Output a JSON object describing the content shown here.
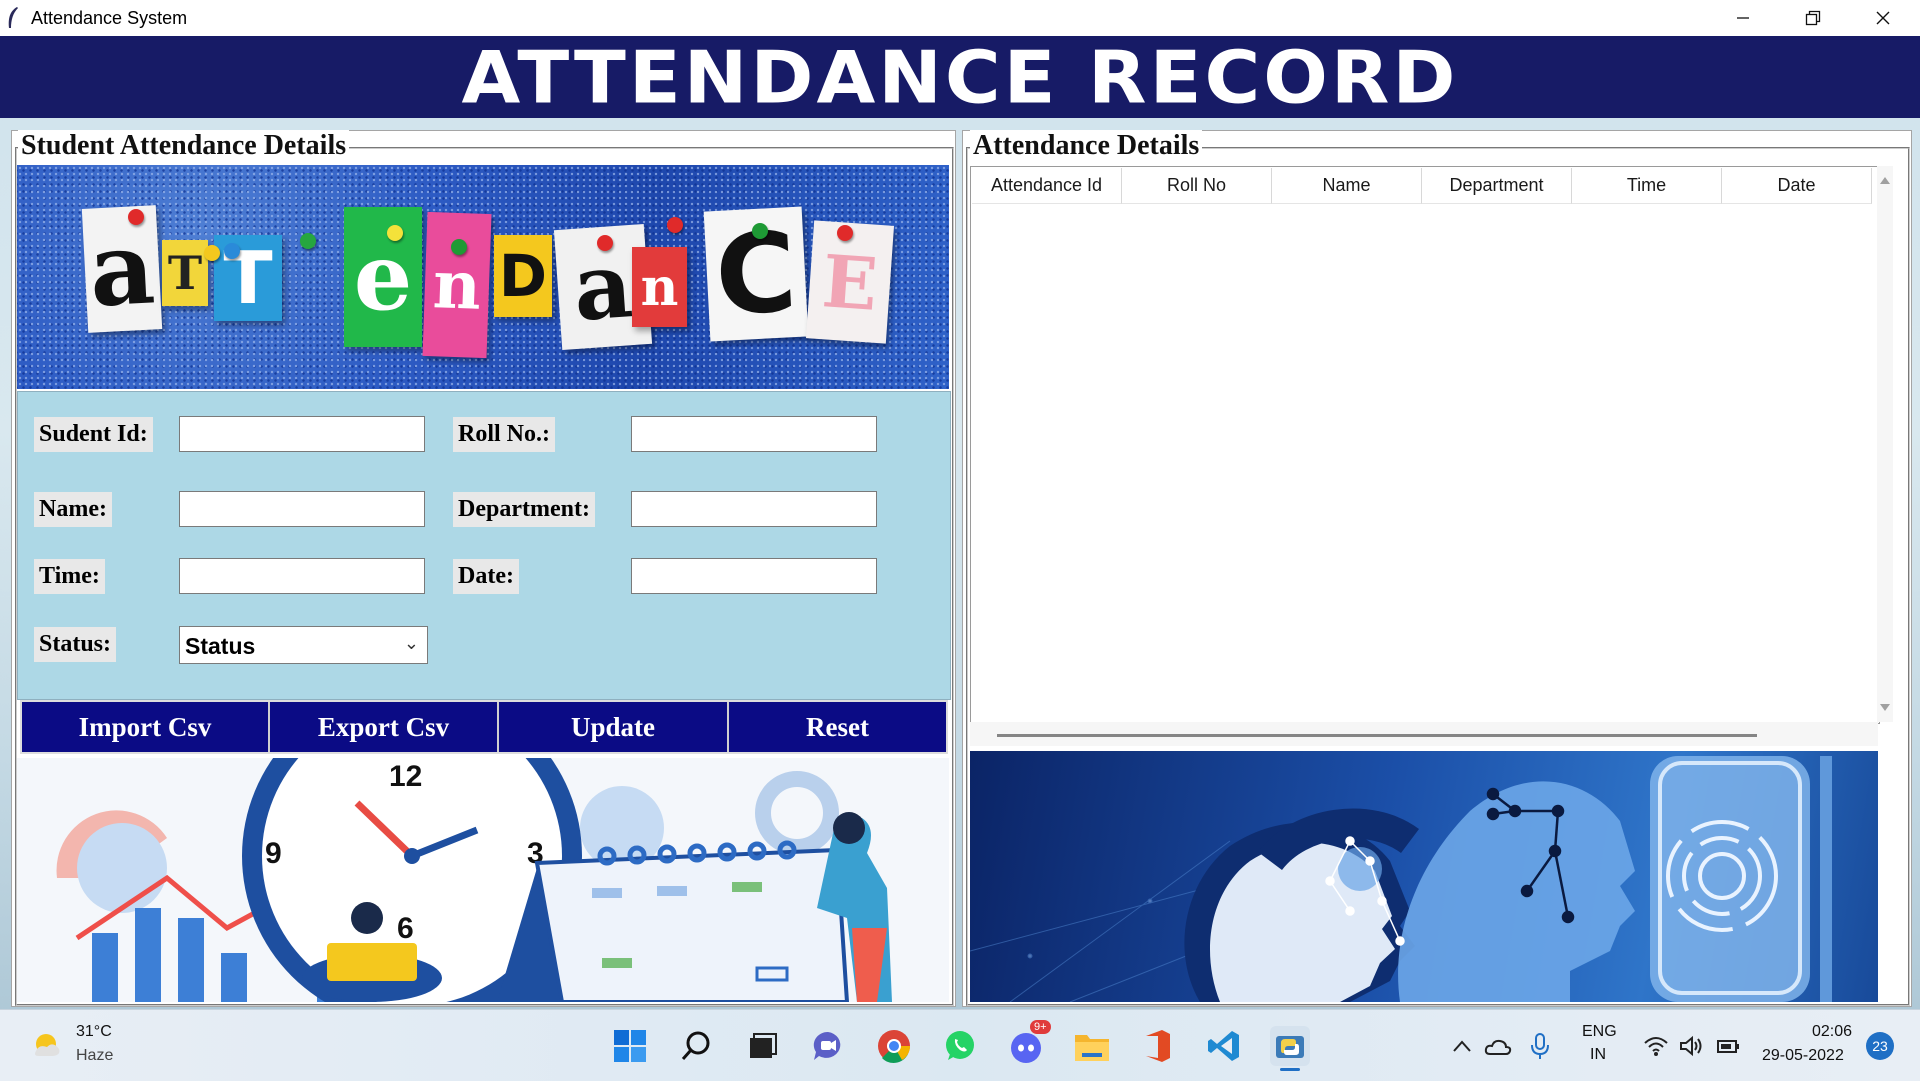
{
  "window": {
    "title": "Attendance System",
    "minimize_icon": "minimize-icon",
    "restore_icon": "restore-icon",
    "close_icon": "close-icon"
  },
  "header": {
    "title": "ATTENDANCE RECORD",
    "color": "#171b66"
  },
  "left_panel": {
    "title": "Student Attendance Details",
    "banner_letters": [
      "a",
      "T",
      "T",
      "e",
      "n",
      "D",
      "a",
      "n",
      "C",
      "E"
    ],
    "form": {
      "student_id_label": "Sudent Id:",
      "roll_no_label": "Roll No.:",
      "name_label": "Name:",
      "department_label": "Department:",
      "time_label": "Time:",
      "date_label": "Date:",
      "status_label": "Status:",
      "student_id_value": "",
      "roll_no_value": "",
      "name_value": "",
      "department_value": "",
      "time_value": "",
      "date_value": "",
      "status_selected": "Status"
    },
    "buttons": {
      "import": "Import Csv",
      "export": "Export Csv",
      "update": "Update",
      "reset": "Reset",
      "color": "#0b0b85"
    },
    "clock_numbers": {
      "twelve": "12",
      "three": "3",
      "six": "6",
      "nine": "9"
    }
  },
  "right_panel": {
    "title": "Attendance Details",
    "table": {
      "columns": [
        "Attendance Id",
        "Roll No",
        "Name",
        "Department",
        "Time",
        "Date"
      ],
      "rows": []
    }
  },
  "taskbar": {
    "weather_temp": "31°C",
    "weather_desc": "Haze",
    "language_line1": "ENG",
    "language_line2": "IN",
    "time": "02:06",
    "date": "29-05-2022",
    "notification_count": "23",
    "discord_badge": "9+"
  }
}
